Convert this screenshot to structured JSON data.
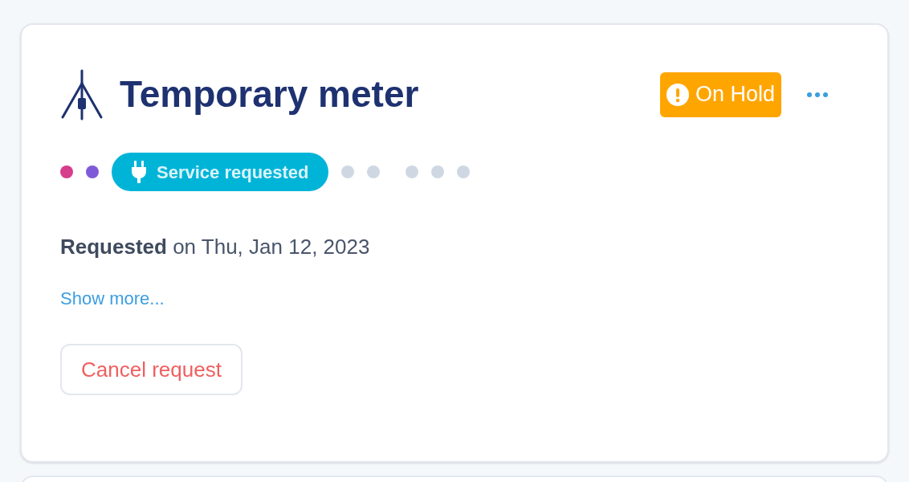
{
  "card": {
    "title": "Temporary meter",
    "status": {
      "kind": "warning",
      "label": "On Hold"
    },
    "progress": {
      "groups": [
        {
          "steps": [
            {
              "kind": "dot",
              "color": "#d63d8a"
            },
            {
              "kind": "dot",
              "color": "#7f5ad8"
            },
            {
              "kind": "current",
              "color": "#00b4d8",
              "label": "Service requested"
            },
            {
              "kind": "dot",
              "color": "#cfd8e2"
            },
            {
              "kind": "dot",
              "color": "#cfd8e2"
            }
          ]
        },
        {
          "steps": [
            {
              "kind": "dot",
              "color": "#cfd8e2"
            },
            {
              "kind": "dot",
              "color": "#cfd8e2"
            },
            {
              "kind": "dot",
              "color": "#cfd8e2"
            }
          ]
        }
      ]
    },
    "requested_text": "**Requested** on Thu, Jan 12, 2023",
    "show_more": "Show more...",
    "cancel_button": "Cancel request"
  }
}
